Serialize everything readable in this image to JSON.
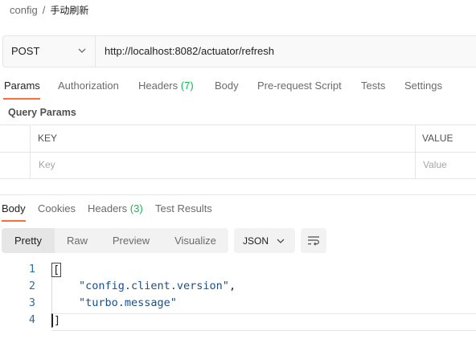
{
  "breadcrumb": {
    "parent": "config",
    "separator": "/",
    "current": "手动刷新"
  },
  "request": {
    "method": "POST",
    "url": "http://localhost:8082/actuator/refresh"
  },
  "request_tabs": [
    {
      "label": "Params",
      "active": true
    },
    {
      "label": "Authorization"
    },
    {
      "label": "Headers",
      "count": "(7)"
    },
    {
      "label": "Body"
    },
    {
      "label": "Pre-request Script"
    },
    {
      "label": "Tests"
    },
    {
      "label": "Settings"
    }
  ],
  "query_params": {
    "title": "Query Params",
    "columns": [
      "KEY",
      "VALUE"
    ],
    "placeholders": {
      "key": "Key",
      "value": "Value"
    }
  },
  "response_tabs": [
    {
      "label": "Body",
      "active": true
    },
    {
      "label": "Cookies"
    },
    {
      "label": "Headers",
      "count": "(3)"
    },
    {
      "label": "Test Results"
    }
  ],
  "view_modes": [
    "Pretty",
    "Raw",
    "Preview",
    "Visualize"
  ],
  "selected_view_mode": "Pretty",
  "format": "JSON",
  "code_lines": [
    {
      "num": "1",
      "text": "["
    },
    {
      "num": "2",
      "text": "\"config.client.version\"",
      "suffix": ","
    },
    {
      "num": "3",
      "text": "\"turbo.message\"",
      "suffix": ""
    },
    {
      "num": "4",
      "text": "]"
    }
  ],
  "colors": {
    "accent": "#ff6c37",
    "count": "#0cbb52",
    "line_number": "#2d6ea3"
  }
}
